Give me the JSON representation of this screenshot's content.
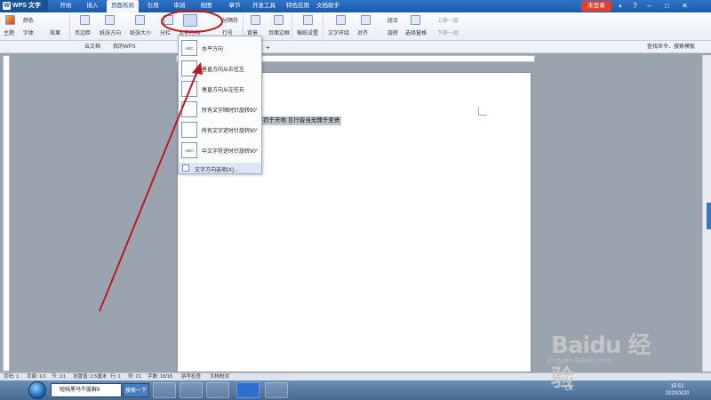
{
  "app": {
    "title": "WPS 文字",
    "login_label": "未登录",
    "controls": [
      "◐",
      "?",
      "–",
      "□",
      "✕"
    ]
  },
  "menu_tabs": [
    "开始",
    "插入",
    "页面布局",
    "引用",
    "审阅",
    "视图",
    "章节",
    "开发工具",
    "特色应用",
    "文档助手"
  ],
  "active_menu_tab": "页面布局",
  "ribbon": {
    "theme": "主题",
    "colors": "颜色",
    "fonts": "字体",
    "effects": "效果",
    "margins": "页边距",
    "orientation": "纸张方向",
    "paper_size": "纸张大小",
    "columns": "分栏",
    "text_direction": "文字方向",
    "line_numbers": "行号",
    "breaks": "分隔符",
    "background": "背景",
    "page_border": "页面边框",
    "manuscript": "稿纸设置",
    "text_wrap": "文字环绕",
    "align": "对齐",
    "rotate": "旋转",
    "group": "组合",
    "selection_pane": "选择窗格",
    "bring_forward": "上移一层",
    "send_backward": "下移一层"
  },
  "tabstrip": {
    "tabs": [
      "云文档",
      "我的WPS"
    ],
    "new_tab": "+",
    "search_placeholder": "查找命令、搜索模板"
  },
  "document": {
    "text": "罚于天地 言行皆当无愧于圣贤"
  },
  "text_direction_menu": {
    "items": [
      {
        "label": "水平方向",
        "icon": "ABC"
      },
      {
        "label": "垂直方向从右往左",
        "icon": "vertical-rl-icon"
      },
      {
        "label": "垂直方向从左往右",
        "icon": "vertical-lr-icon"
      },
      {
        "label": "所有文字顺时针旋转90°",
        "icon": "rotate-cw-icon"
      },
      {
        "label": "所有文字逆时针旋转90°",
        "icon": "rotate-ccw-icon"
      },
      {
        "label": "中文字符逆时针旋转90°",
        "icon": "ABC"
      }
    ],
    "options_label": "文字方向选项(X)..."
  },
  "status_bar": {
    "page_num": "页码: 1",
    "pages": "页面: 1/1",
    "section": "节: 1/1",
    "set_value": "设置值: 2.5厘米",
    "row": "行: 1",
    "column": "列: 21",
    "word_count": "字数: 18/18",
    "spell_check": "拼写检查",
    "doc_check": "文档校对"
  },
  "taskbar": {
    "search_value": "短线黑马牛股群9",
    "search_button": "搜索一下",
    "tray_lang": "CK",
    "time": "15:51",
    "date": "2020/3/20"
  },
  "watermark": {
    "brand": "Baidu 经验",
    "url": "jingyan.baidu.com"
  },
  "colors": {
    "accent": "#1d5fb0",
    "annotation_red": "#c0191d",
    "login_red": "#e2402c"
  }
}
